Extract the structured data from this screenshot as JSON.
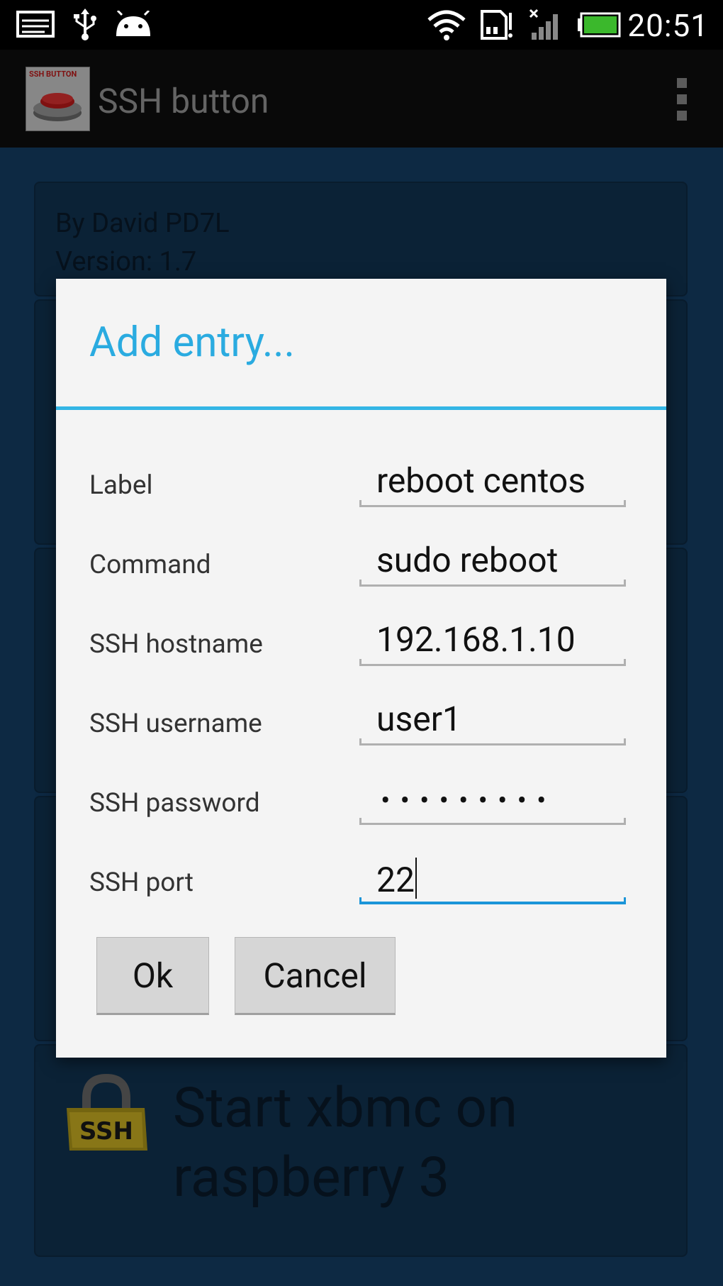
{
  "status_bar": {
    "time": "20:51",
    "icons": [
      "screen-icon",
      "usb-icon",
      "android-icon",
      "wifi-icon",
      "sd-card-icon",
      "signal-no-service-icon",
      "battery-icon"
    ],
    "battery_color": "#3bb82c"
  },
  "action_bar": {
    "title": "SSH button",
    "logo_text": "SSH BUTTON"
  },
  "background": {
    "info_card": {
      "author": "By David PD7L",
      "version": "Version: 1.7"
    },
    "bottom_card": {
      "title_line1": "Start xbmc on",
      "title_line2": "raspberry 3",
      "icon_text": "SSH"
    }
  },
  "dialog": {
    "title": "Add entry...",
    "fields": [
      {
        "label": "Label",
        "value": "reboot centos"
      },
      {
        "label": "Command",
        "value": "sudo reboot"
      },
      {
        "label": "SSH hostname",
        "value": "192.168.1.10"
      },
      {
        "label": "SSH username",
        "value": "user1"
      },
      {
        "label": "SSH password",
        "value": "•••••••••"
      },
      {
        "label": "SSH port",
        "value": "22"
      }
    ],
    "ok_label": "Ok",
    "cancel_label": "Cancel",
    "accent_color": "#33b5e5"
  }
}
